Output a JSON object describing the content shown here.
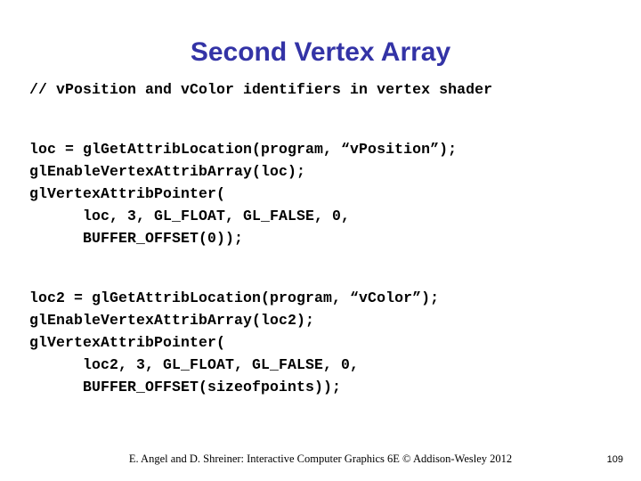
{
  "slide": {
    "title": "Second Vertex Array",
    "title_color": "#3333A6",
    "background_color": "#FFFFFF",
    "text_color": "#000000"
  },
  "code": {
    "comment_line": "// vPosition and vColor identifiers in vertex shader",
    "block1": [
      "loc = glGetAttribLocation(program, “vPosition”);",
      "glEnableVertexAttribArray(loc);",
      "glVertexAttribPointer(",
      "      loc, 3, GL_FLOAT, GL_FALSE, 0,",
      "      BUFFER_OFFSET(0));"
    ],
    "block2": [
      "loc2 = glGetAttribLocation(program, “vColor”);",
      "glEnableVertexAttribArray(loc2);",
      "glVertexAttribPointer(",
      "      loc2, 3, GL_FLOAT, GL_FALSE, 0,",
      "      BUFFER_OFFSET(sizeofpoints));"
    ]
  },
  "footer": {
    "credit": "E. Angel and D. Shreiner: Interactive Computer Graphics 6E © Addison-Wesley 2012",
    "page_number": "109"
  }
}
